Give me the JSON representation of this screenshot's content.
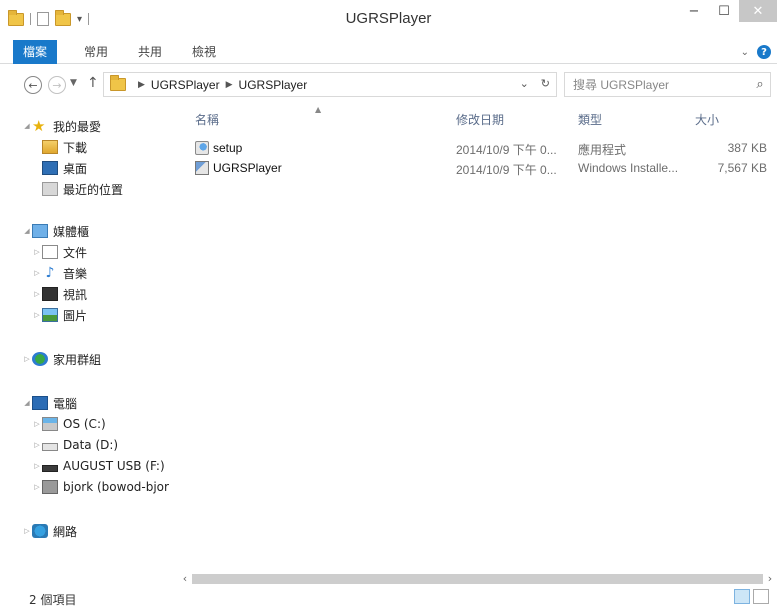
{
  "window": {
    "title": "UGRSPlayer",
    "minimize": "−",
    "maximize": "☐",
    "close": "✕"
  },
  "ribbon": {
    "tabs": [
      "檔案",
      "常用",
      "共用",
      "檢視"
    ],
    "expand_glyph": "⌄",
    "help_glyph": "?"
  },
  "address": {
    "breadcrumb": [
      "UGRSPlayer",
      "UGRSPlayer"
    ],
    "search_placeholder": "搜尋 UGRSPlayer"
  },
  "sidebar": {
    "favorites": {
      "label": "我的最愛",
      "items": [
        "下載",
        "桌面",
        "最近的位置"
      ]
    },
    "libraries": {
      "label": "媒體櫃",
      "items": [
        "文件",
        "音樂",
        "視訊",
        "圖片"
      ]
    },
    "homegroup": {
      "label": "家用群組"
    },
    "computer": {
      "label": "電腦",
      "items": [
        "OS (C:)",
        "Data (D:)",
        "AUGUST USB (F:)",
        "bjork (bowod-bjor"
      ]
    },
    "network": {
      "label": "網路"
    }
  },
  "columns": [
    "名稱",
    "修改日期",
    "類型",
    "大小"
  ],
  "files": [
    {
      "name": "setup",
      "date": "2014/10/9 下午 0...",
      "type": "應用程式",
      "size": "387 KB"
    },
    {
      "name": "UGRSPlayer",
      "date": "2014/10/9 下午 0...",
      "type": "Windows Installe...",
      "size": "7,567 KB"
    }
  ],
  "status": {
    "item_count": "2 個項目"
  }
}
